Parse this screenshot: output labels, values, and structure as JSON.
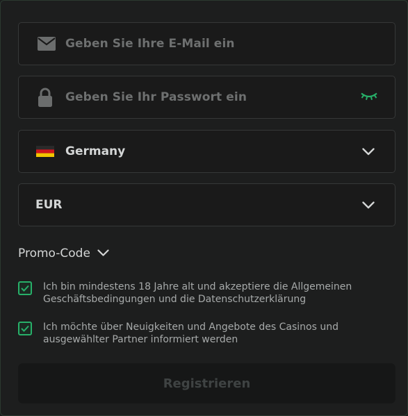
{
  "form": {
    "email": {
      "placeholder": "Geben Sie Ihre E-Mail ein",
      "icon": "envelope-icon"
    },
    "password": {
      "placeholder": "Geben Sie Ihr Passwort ein",
      "icon": "lock-icon",
      "toggle_icon": "eye-closed-icon"
    },
    "country": {
      "value": "Germany",
      "flag_icon": "germany-flag-icon"
    },
    "currency": {
      "value": "EUR"
    },
    "promo": {
      "label": "Promo-Code"
    },
    "checkboxes": [
      {
        "checked": true,
        "text": "Ich bin mindestens 18 Jahre alt und akzeptiere die Allgemeinen Geschäftsbedingungen und die Datenschutzerklärung"
      },
      {
        "checked": true,
        "text": "Ich möchte über Neuigkeiten und Angebote des Casinos und ausgewählter Partner informiert werden"
      }
    ],
    "register_label": "Registrieren"
  },
  "colors": {
    "accent": "#27b069",
    "background": "#1d1e1e",
    "field_background": "#1a1a1a"
  }
}
